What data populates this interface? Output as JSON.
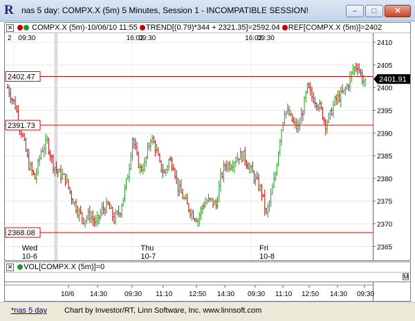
{
  "window": {
    "title": "nas 5 day: COMPX.X (5m) 5 Minutes, Session 1 - INCOMPATIBLE SESSION!",
    "buttons": {
      "minimize": "–",
      "maximize": "□",
      "close": "✕"
    }
  },
  "price_pane": {
    "legend_prefix": "✕",
    "legend_symbol": "COMPX.X (5m)-10/06/10 11:55",
    "legend_trend": "TREND[(0.79)*344 + 2321.35]=2592.04",
    "legend_ref": "REF[COMPX.X (5m)]=2402",
    "top_labels": [
      {
        "text": "2",
        "xd": 0
      },
      {
        "text": "09:30",
        "xd": 7
      },
      {
        "text": "16:02",
        "xd": 78
      },
      {
        "text": "09:30",
        "xd": 86
      },
      {
        "text": "16:02",
        "xd": 156
      },
      {
        "text": "09:30",
        "xd": 164
      }
    ],
    "last_price": "2401.91"
  },
  "volume_pane": {
    "legend": "VOL[COMPX.X (5m)]=0",
    "m_label": "M",
    "x_labels": [
      "10/6",
      "14:30",
      "09:30",
      "11:10",
      "12:50",
      "14:30",
      "09:30",
      "11:10",
      "12:50",
      "14:30",
      "09:30"
    ]
  },
  "status_bar": {
    "tab": "*nas 5 day",
    "credit": "Chart by Investor/RT, Linn Software, Inc. www.linnsoft.com"
  },
  "colors": {
    "up": "#1a9a1a",
    "down": "#c00000",
    "line": "#dd0000",
    "vol_bar": "#000000"
  },
  "chart_data": {
    "type": "candlestick",
    "title": "COMPX.X (5m)",
    "ylim": [
      2362,
      2412
    ],
    "y_ticks": [
      2365,
      2370,
      2375,
      2380,
      2385,
      2390,
      2395,
      2400,
      2405,
      2410
    ],
    "reference_lines": [
      {
        "label": "2402.47",
        "value": 2402.47
      },
      {
        "label": "2391.73",
        "value": 2391.73
      },
      {
        "label": "2368.08",
        "value": 2368.08
      }
    ],
    "day_labels": [
      {
        "day": "Wed",
        "date": "10-6",
        "xd": 4
      },
      {
        "day": "Thu",
        "date": "10-7",
        "xd": 82
      },
      {
        "day": "Fri",
        "date": "10-8",
        "xd": 160
      }
    ],
    "close_path": [
      [
        0,
        2400
      ],
      [
        5,
        2396
      ],
      [
        10,
        2389
      ],
      [
        14,
        2383
      ],
      [
        18,
        2380
      ],
      [
        22,
        2386
      ],
      [
        26,
        2388
      ],
      [
        30,
        2383
      ],
      [
        34,
        2381
      ],
      [
        38,
        2380
      ],
      [
        42,
        2376
      ],
      [
        46,
        2373
      ],
      [
        50,
        2371
      ],
      [
        54,
        2372
      ],
      [
        58,
        2370
      ],
      [
        62,
        2373
      ],
      [
        66,
        2374
      ],
      [
        70,
        2371
      ],
      [
        74,
        2373
      ],
      [
        78,
        2379
      ],
      [
        80,
        2383
      ],
      [
        82,
        2389
      ],
      [
        84,
        2386
      ],
      [
        87,
        2382
      ],
      [
        90,
        2383
      ],
      [
        94,
        2389
      ],
      [
        97,
        2387
      ],
      [
        100,
        2383
      ],
      [
        103,
        2381
      ],
      [
        106,
        2384
      ],
      [
        109,
        2383
      ],
      [
        112,
        2378
      ],
      [
        115,
        2376
      ],
      [
        118,
        2374
      ],
      [
        120,
        2373
      ],
      [
        122,
        2372
      ],
      [
        125,
        2371
      ],
      [
        128,
        2374
      ],
      [
        131,
        2375
      ],
      [
        134,
        2375
      ],
      [
        137,
        2374
      ],
      [
        140,
        2380
      ],
      [
        143,
        2383
      ],
      [
        146,
        2383
      ],
      [
        149,
        2384
      ],
      [
        152,
        2385
      ],
      [
        155,
        2385
      ],
      [
        158,
        2383
      ],
      [
        161,
        2381
      ],
      [
        164,
        2379
      ],
      [
        167,
        2377
      ],
      [
        170,
        2372
      ],
      [
        173,
        2376
      ],
      [
        176,
        2381
      ],
      [
        179,
        2389
      ],
      [
        182,
        2395
      ],
      [
        185,
        2394
      ],
      [
        188,
        2392
      ],
      [
        191,
        2391
      ],
      [
        194,
        2395
      ],
      [
        197,
        2400
      ],
      [
        200,
        2398
      ],
      [
        203,
        2397
      ],
      [
        206,
        2395
      ],
      [
        209,
        2392
      ],
      [
        212,
        2394
      ],
      [
        215,
        2397
      ],
      [
        218,
        2398
      ],
      [
        221,
        2399
      ],
      [
        224,
        2401
      ],
      [
        227,
        2404
      ],
      [
        230,
        2405
      ],
      [
        233,
        2402
      ],
      [
        235,
        2401
      ]
    ]
  }
}
